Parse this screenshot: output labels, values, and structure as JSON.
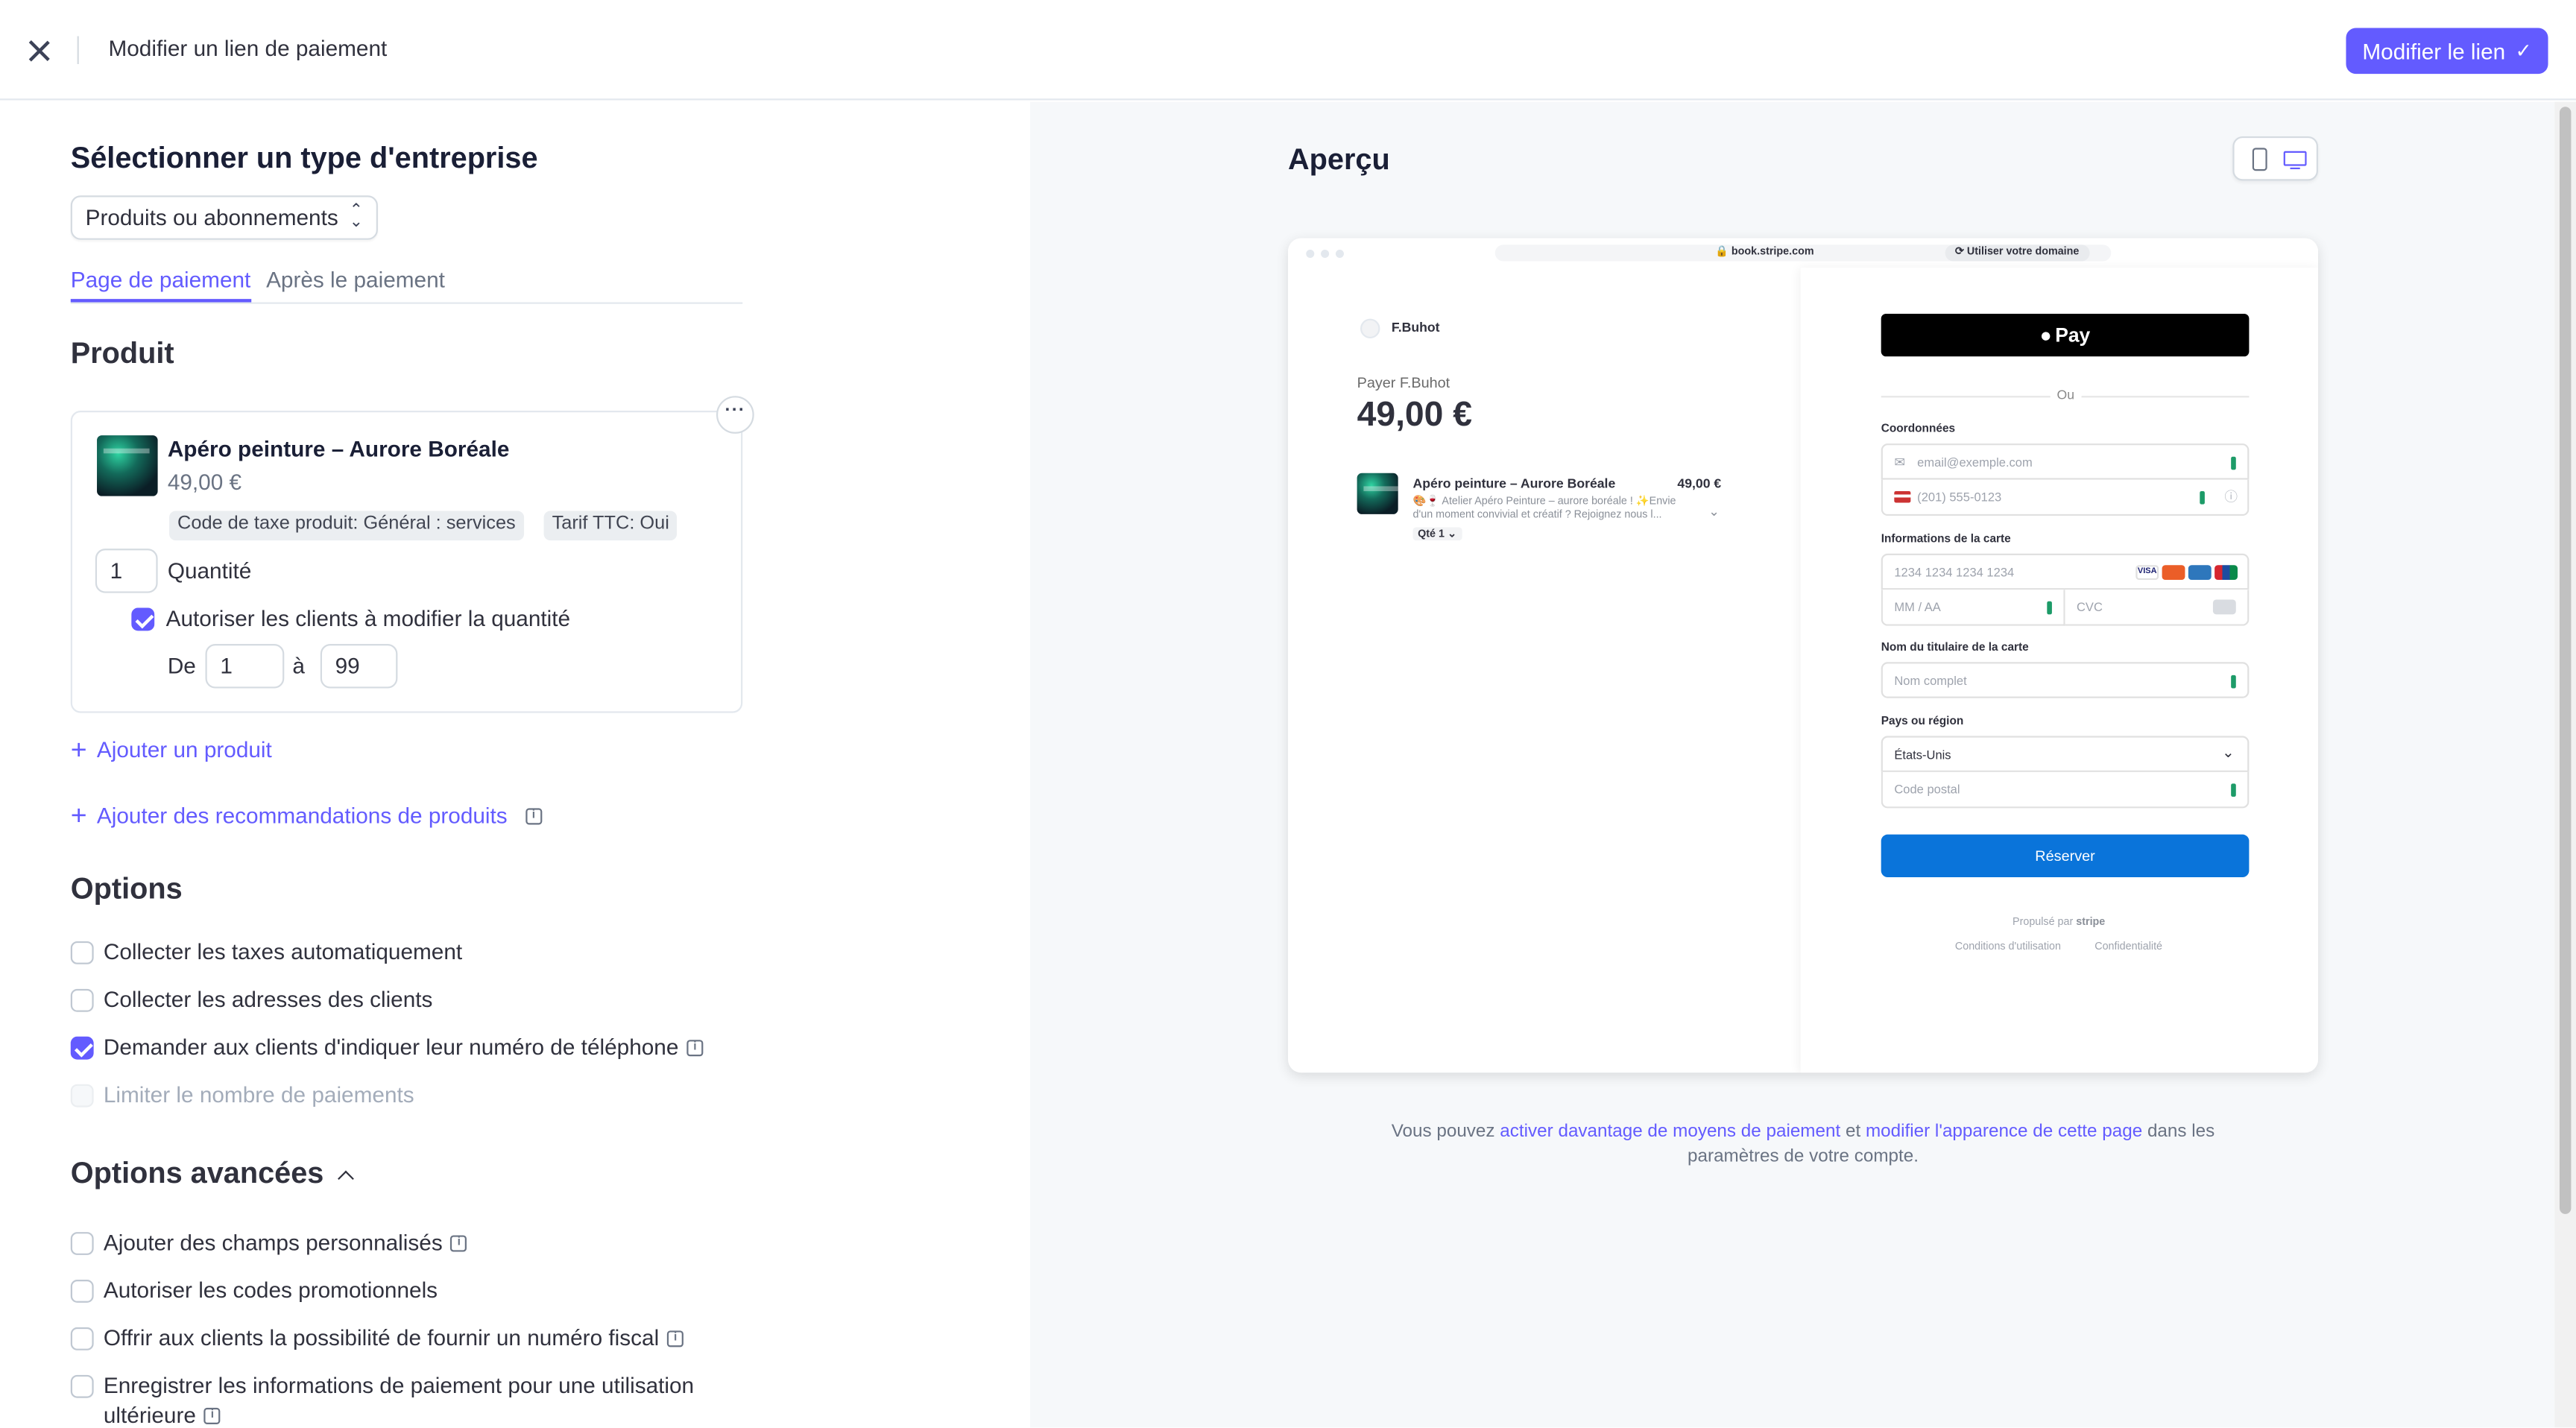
{
  "header": {
    "title": "Modifier un lien de paiement",
    "primary_button": "Modifier le lien"
  },
  "left": {
    "business_type_title": "Sélectionner un type d'entreprise",
    "business_type_value": "Produits ou abonnements",
    "tabs": [
      {
        "label": "Page de paiement",
        "active": true
      },
      {
        "label": "Après le paiement",
        "active": false
      }
    ],
    "product_section_title": "Produit",
    "product": {
      "name": "Apéro peinture – Aurore Boréale",
      "price": "49,00 €",
      "badges": [
        "Code de taxe produit: Général : services",
        "Tarif TTC: Oui"
      ],
      "quantity_value": "1",
      "quantity_label": "Quantité",
      "allow_adjust_label": "Autoriser les clients à modifier la quantité",
      "from_label": "De",
      "min_value": "1",
      "to_label": "à",
      "max_value": "99"
    },
    "add_product": "Ajouter un produit",
    "add_recommendations": "Ajouter des recommandations de produits",
    "options_title": "Options",
    "options": [
      {
        "label": "Collecter les taxes automatiquement",
        "checked": false,
        "disabled": false,
        "info": false
      },
      {
        "label": "Collecter les adresses des clients",
        "checked": false,
        "disabled": false,
        "info": false
      },
      {
        "label": "Demander aux clients d'indiquer leur numéro de téléphone",
        "checked": true,
        "disabled": false,
        "info": true
      },
      {
        "label": "Limiter le nombre de paiements",
        "checked": false,
        "disabled": true,
        "info": false
      }
    ],
    "advanced_title": "Options avancées",
    "advanced_options": [
      {
        "label": "Ajouter des champs personnalisés",
        "checked": false,
        "info": true
      },
      {
        "label": "Autoriser les codes promotionnels",
        "checked": false,
        "info": false
      },
      {
        "label": "Offrir aux clients la possibilité de fournir un numéro fiscal",
        "checked": false,
        "info": true
      },
      {
        "label": "Enregistrer les informations de paiement pour une utilisation",
        "label_cont": "ultérieure",
        "checked": false,
        "info": true
      }
    ]
  },
  "preview": {
    "title": "Aperçu",
    "browser": {
      "url": "book.stripe.com",
      "domain_pill": "Utiliser votre domaine"
    },
    "checkout_left": {
      "merchant": "F.Buhot",
      "pay_label": "Payer F.Buhot",
      "total": "49,00 €",
      "item_name": "Apéro peinture – Aurore Boréale",
      "item_price": "49,00 €",
      "item_desc_1": "🎨🍷 Atelier Apéro Peinture – aurore boréale ! ✨Envie",
      "item_desc_2": "d'un moment convivial et créatif ? Rejoignez nous l...",
      "item_qty": "Qté 1"
    },
    "checkout_right": {
      "apple_pay": "Pay",
      "or": "Ou",
      "contact_label": "Coordonnées",
      "email_placeholder": "email@exemple.com",
      "phone_placeholder": "(201) 555-0123",
      "card_label": "Informations de la carte",
      "card_placeholder": "1234 1234 1234 1234",
      "expiry_placeholder": "MM / AA",
      "cvc_placeholder": "CVC",
      "name_label": "Nom du titulaire de la carte",
      "name_placeholder": "Nom complet",
      "country_label": "Pays ou région",
      "country_value": "États-Unis",
      "postal_placeholder": "Code postal",
      "submit": "Réserver",
      "powered_by": "Propulsé par",
      "powered_brand": "stripe",
      "terms": "Conditions d'utilisation",
      "privacy": "Confidentialité"
    },
    "footer": {
      "prefix": "Vous pouvez ",
      "link1": "activer davantage de moyens de paiement",
      "middle": " et ",
      "link2": "modifier l'apparence de cette page",
      "suffix": " dans les",
      "line2": "paramètres de votre compte."
    }
  },
  "colors": {
    "accent": "#635bff",
    "submit_blue": "#0a74da",
    "preview_bg": "#f6f8fa"
  }
}
